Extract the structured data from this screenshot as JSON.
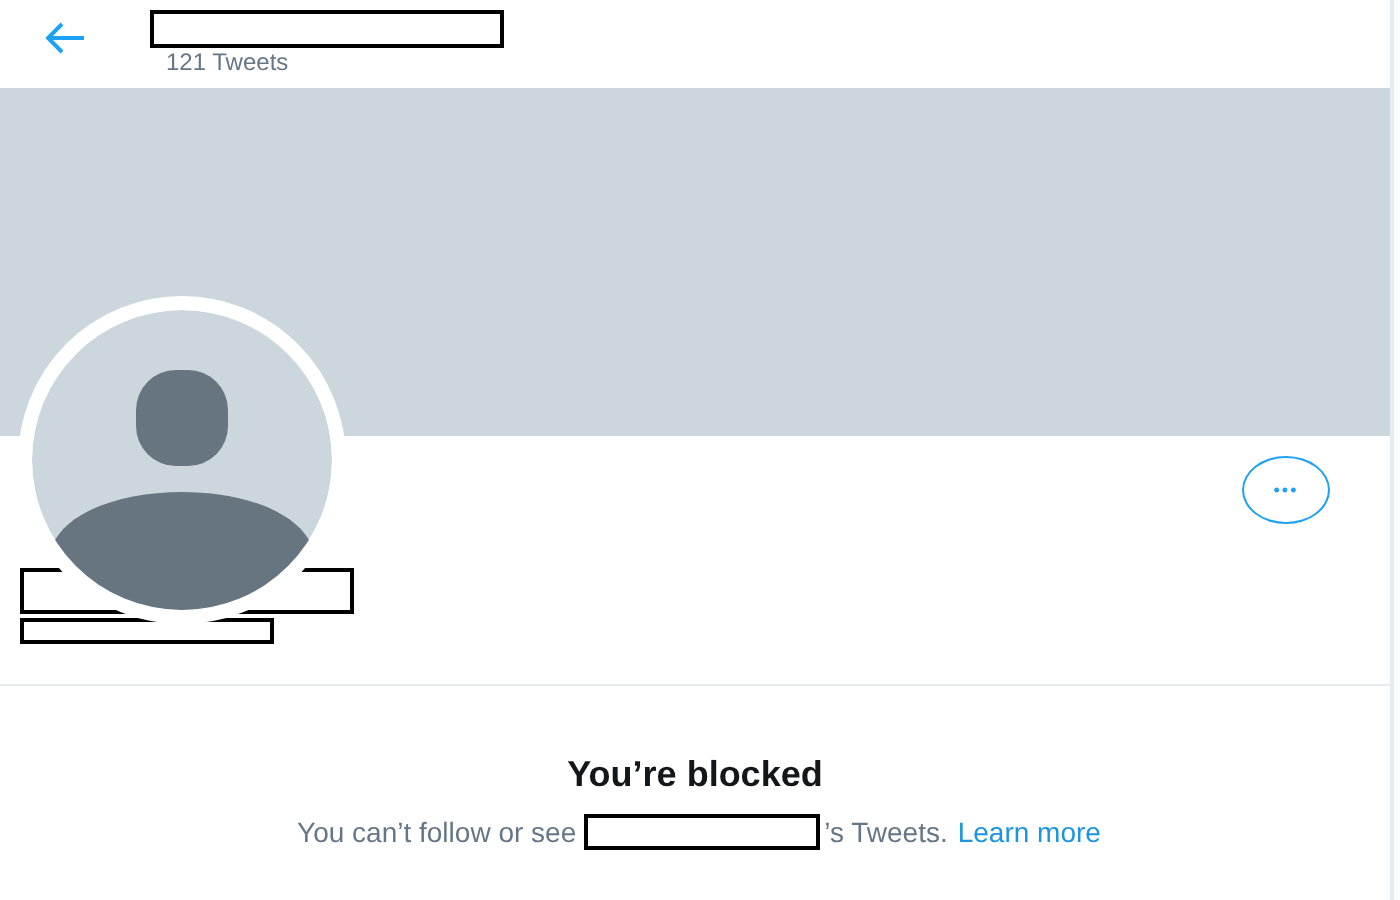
{
  "header": {
    "tweet_count": "121 Tweets"
  },
  "more_button": {
    "label": "•••"
  },
  "blocked": {
    "title": "You’re blocked",
    "before": "You can’t follow or see",
    "after": "’s Tweets.",
    "link": "Learn more"
  }
}
